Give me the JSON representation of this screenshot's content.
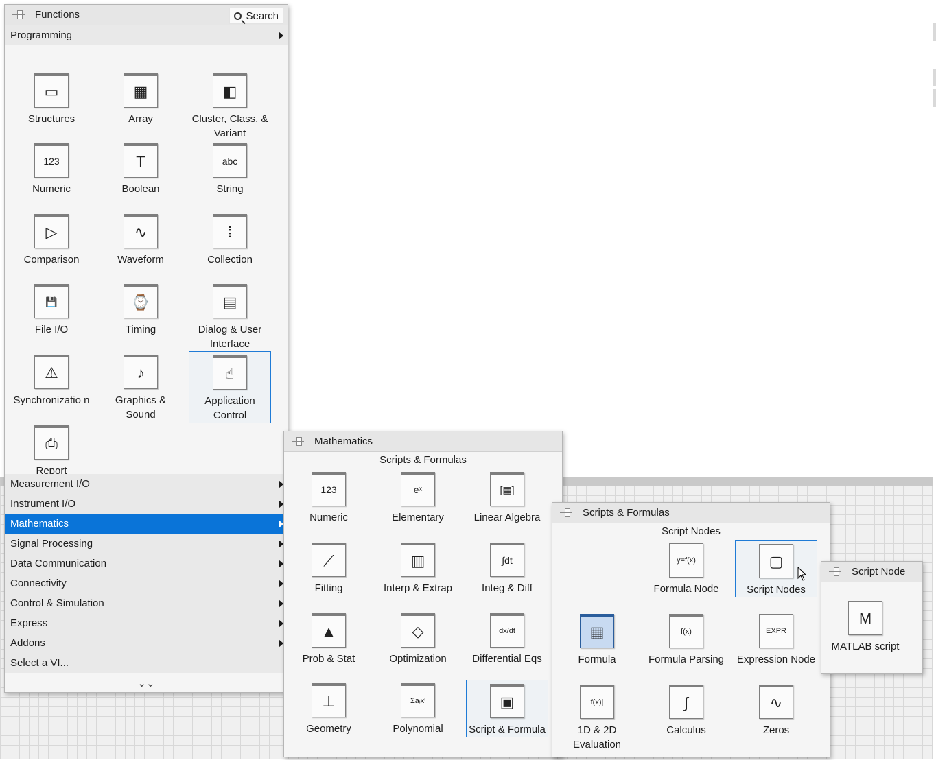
{
  "functions_palette": {
    "title": "Functions",
    "search_label": "Search",
    "category": "Programming",
    "items": [
      {
        "label": "Structures",
        "icon": "structures-icon",
        "glyph": "▭"
      },
      {
        "label": "Array",
        "icon": "array-icon",
        "glyph": "▦"
      },
      {
        "label": "Cluster, Class, & Variant",
        "icon": "cluster-icon",
        "glyph": "◧"
      },
      {
        "label": "Numeric",
        "icon": "numeric-icon",
        "glyph": "123"
      },
      {
        "label": "Boolean",
        "icon": "boolean-icon",
        "glyph": "T"
      },
      {
        "label": "String",
        "icon": "string-icon",
        "glyph": "abc"
      },
      {
        "label": "Comparison",
        "icon": "comparison-icon",
        "glyph": "▷"
      },
      {
        "label": "Waveform",
        "icon": "waveform-icon",
        "glyph": "∿"
      },
      {
        "label": "Collection",
        "icon": "collection-icon",
        "glyph": "⁞"
      },
      {
        "label": "File I/O",
        "icon": "file-io-icon",
        "glyph": "💾"
      },
      {
        "label": "Timing",
        "icon": "timing-icon",
        "glyph": "⌚"
      },
      {
        "label": "Dialog & User Interface",
        "icon": "dialog-icon",
        "glyph": "▤"
      },
      {
        "label": "Synchronizatio n",
        "icon": "synchronization-icon",
        "glyph": "⚠"
      },
      {
        "label": "Graphics & Sound",
        "icon": "graphics-sound-icon",
        "glyph": "♪"
      },
      {
        "label": "Application Control",
        "icon": "application-control-icon",
        "glyph": "☝"
      },
      {
        "label": "Report Generation",
        "icon": "report-generation-icon",
        "glyph": "⎙"
      }
    ],
    "categories": [
      {
        "label": "Measurement I/O"
      },
      {
        "label": "Instrument I/O"
      },
      {
        "label": "Mathematics"
      },
      {
        "label": "Signal Processing"
      },
      {
        "label": "Data Communication"
      },
      {
        "label": "Connectivity"
      },
      {
        "label": "Control & Simulation"
      },
      {
        "label": "Express"
      },
      {
        "label": "Addons"
      },
      {
        "label": "Select a VI..."
      }
    ],
    "more": "⌄⌄"
  },
  "mathematics_palette": {
    "title": "Mathematics",
    "subheader": "Scripts & Formulas",
    "items": [
      {
        "label": "Numeric",
        "icon": "numeric-icon",
        "glyph": "123"
      },
      {
        "label": "Elementary",
        "icon": "elementary-icon",
        "glyph": "eˣ"
      },
      {
        "label": "Linear Algebra",
        "icon": "linear-algebra-icon",
        "glyph": "[▦]"
      },
      {
        "label": "Fitting",
        "icon": "fitting-icon",
        "glyph": "⟋"
      },
      {
        "label": "Interp & Extrap",
        "icon": "interp-icon",
        "glyph": "▥"
      },
      {
        "label": "Integ & Diff",
        "icon": "integ-diff-icon",
        "glyph": "∫dt"
      },
      {
        "label": "Prob & Stat",
        "icon": "prob-stat-icon",
        "glyph": "▲"
      },
      {
        "label": "Optimization",
        "icon": "optimization-icon",
        "glyph": "◇"
      },
      {
        "label": "Differential Eqs",
        "icon": "differential-eqs-icon",
        "glyph": "dx/dt"
      },
      {
        "label": "Geometry",
        "icon": "geometry-icon",
        "glyph": "⊥"
      },
      {
        "label": "Polynomial",
        "icon": "polynomial-icon",
        "glyph": "Σaᵢxⁱ"
      },
      {
        "label": "Script & Formula",
        "icon": "script-formula-icon",
        "glyph": "▣"
      }
    ]
  },
  "scripts_palette": {
    "title": "Scripts & Formulas",
    "subheader": "Script Nodes",
    "items": [
      {
        "label": "Formula Node",
        "icon": "formula-node-icon",
        "glyph": "y=f(x)"
      },
      {
        "label": "Script Nodes",
        "icon": "script-nodes-icon",
        "glyph": "▢"
      },
      {
        "label": "Formula",
        "icon": "formula-icon",
        "glyph": "▦"
      },
      {
        "label": "Formula Parsing",
        "icon": "formula-parsing-icon",
        "glyph": "f(x)"
      },
      {
        "label": "Expression Node",
        "icon": "expression-node-icon",
        "glyph": "EXPR"
      },
      {
        "label": "1D & 2D Evaluation",
        "icon": "evaluation-icon",
        "glyph": "f(x)|"
      },
      {
        "label": "Calculus",
        "icon": "calculus-icon",
        "glyph": "∫"
      },
      {
        "label": "Zeros",
        "icon": "zeros-icon",
        "glyph": "∿"
      }
    ]
  },
  "script_node_palette": {
    "title": "Script Node",
    "items": [
      {
        "label": "MATLAB script",
        "icon": "matlab-script-icon",
        "glyph": "M"
      }
    ]
  }
}
